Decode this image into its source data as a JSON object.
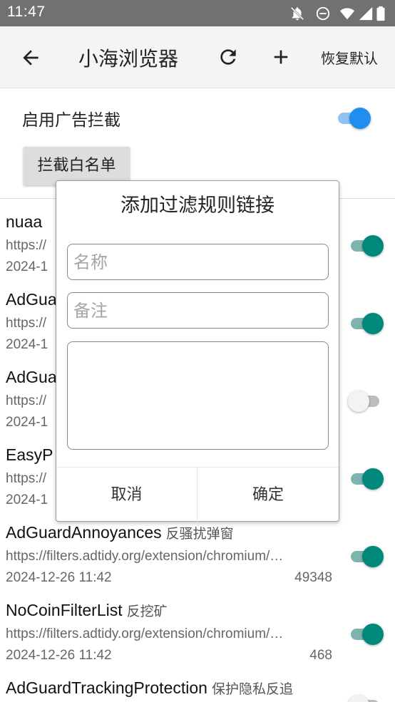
{
  "status_bar": {
    "time": "11:47",
    "icons": [
      "notifications-off-icon",
      "do-not-disturb-icon",
      "wifi-icon",
      "signal-icon",
      "battery-icon"
    ]
  },
  "app_bar": {
    "title": "小海浏览器",
    "restore_label": "恢复默认",
    "icons": [
      "back-arrow-icon",
      "refresh-icon",
      "add-icon"
    ]
  },
  "settings": {
    "enable_label": "启用广告拦截",
    "enable_on": true,
    "whitelist_label": "拦截白名单"
  },
  "filters": [
    {
      "name": "nuaa",
      "desc": "",
      "url": "https://",
      "date": "2024-1",
      "count": "",
      "enabled": true
    },
    {
      "name": "AdGua",
      "desc": "",
      "url": "https://",
      "date": "2024-1",
      "count": "",
      "enabled": true
    },
    {
      "name": "AdGua",
      "desc": "",
      "url": "https://",
      "date": "2024-1",
      "count": "",
      "enabled": false
    },
    {
      "name": "EasyP",
      "desc": "",
      "url": "https://",
      "date": "2024-1",
      "count": "",
      "enabled": true
    },
    {
      "name": "AdGuardAnnoyances",
      "desc": "反骚扰弹窗",
      "url": "https://filters.adtidy.org/extension/chromium/…",
      "date": "2024-12-26 11:42",
      "count": "49348",
      "enabled": true
    },
    {
      "name": "NoCoinFilterList",
      "desc": "反挖矿",
      "url": "https://filters.adtidy.org/extension/chromium/…",
      "date": "2024-12-26 11:42",
      "count": "468",
      "enabled": true
    },
    {
      "name": "AdGuardTrackingProtection",
      "desc": "保护隐私反追",
      "url": "",
      "date": "",
      "count": "",
      "enabled": false
    }
  ],
  "dialog": {
    "title": "添加过滤规则链接",
    "name_placeholder": "名称",
    "note_placeholder": "备注",
    "url_value": "",
    "cancel_label": "取消",
    "ok_label": "确定"
  },
  "colors": {
    "status_bar": "#717171",
    "app_bar": "#f4f4f4",
    "switch_on": "#00897b",
    "master_switch_on": "#1f8ef0",
    "switch_off": "#f3f3f3"
  }
}
